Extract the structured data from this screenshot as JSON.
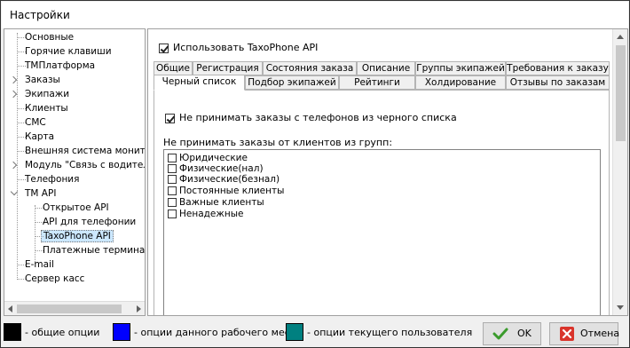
{
  "window": {
    "title": "Настройки"
  },
  "tree": {
    "items": [
      {
        "label": "Основные"
      },
      {
        "label": "Горячие клавиши"
      },
      {
        "label": "ТМПлатформа"
      },
      {
        "label": "Заказы"
      },
      {
        "label": "Экипажи"
      },
      {
        "label": "Клиенты"
      },
      {
        "label": "СМС"
      },
      {
        "label": "Карта"
      },
      {
        "label": "Внешняя система мониторинга"
      },
      {
        "label": "Модуль \"Связь с водителями\""
      },
      {
        "label": "Телефония"
      },
      {
        "label": "TM API"
      },
      {
        "label": "Открытое API"
      },
      {
        "label": "API для телефонии"
      },
      {
        "label": "TaxoPhone API"
      },
      {
        "label": "Платежные терминалы"
      },
      {
        "label": "E-mail"
      },
      {
        "label": "Сервер касс"
      }
    ]
  },
  "panel": {
    "use_api_label": "Использовать TaxoPhone API",
    "use_api_checked": true,
    "tabs_row1": [
      "Общие",
      "Регистрация",
      "Состояния заказа",
      "Описание",
      "Группы экипажей",
      "Требования к заказу"
    ],
    "tabs_row2": [
      "Черный список",
      "Подбор экипажей",
      "Рейтинги",
      "Холдирование",
      "Отзывы по заказам"
    ],
    "active_tab": "Черный список",
    "blacklist_label": "Не принимать заказы с телефонов из черного списка",
    "blacklist_checked": true,
    "groups_label": "Не принимать заказы от клиентов из групп:",
    "groups": [
      {
        "label": "Юридические",
        "checked": false
      },
      {
        "label": "Физические(нал)",
        "checked": false
      },
      {
        "label": "Физические(безнал)",
        "checked": false
      },
      {
        "label": "Постоянные клиенты",
        "checked": false
      },
      {
        "label": "Важные клиенты",
        "checked": false
      },
      {
        "label": "Ненадежные",
        "checked": false
      }
    ]
  },
  "legend": {
    "common": {
      "label": "- общие опции",
      "color": "#000000"
    },
    "workplace": {
      "label": "- опции данного рабочего места",
      "color": "#0000ff"
    },
    "user": {
      "label": "- опции текущего пользователя",
      "color": "#008080"
    }
  },
  "buttons": {
    "ok": "OK",
    "cancel": "Отмена"
  },
  "icons": {
    "ok": "checkmark-icon",
    "cancel": "cancel-x-icon"
  }
}
